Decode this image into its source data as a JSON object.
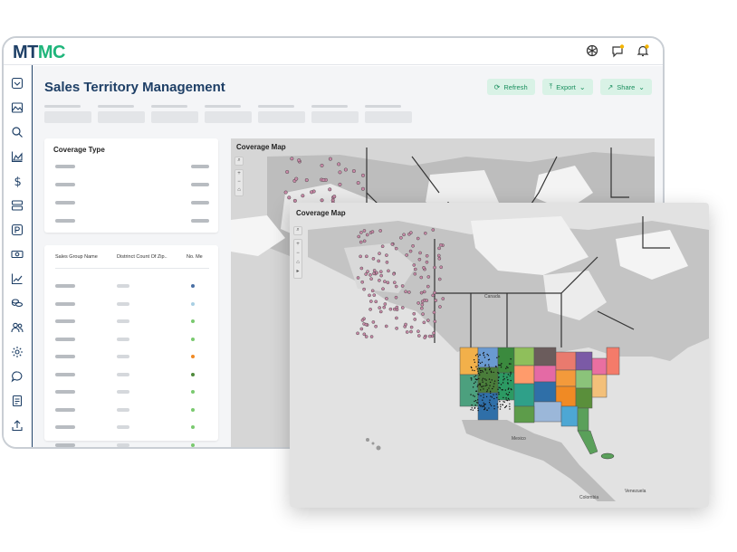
{
  "app": {
    "logo_part1": "MT",
    "logo_part2": "MC"
  },
  "page": {
    "title": "Sales Territory Management"
  },
  "actions": {
    "refresh": "Refresh",
    "export": "Export",
    "share": "Share"
  },
  "coverage_type": {
    "title": "Coverage Type"
  },
  "table": {
    "columns": [
      "Sales Group Name",
      "Distrinct Count Of Zip..",
      "No. Me"
    ],
    "dot_colors": [
      "#4a6fa5",
      "#a9cfe3",
      "#7ac96f",
      "#7ac96f",
      "#f08a24",
      "#4f8a3c",
      "#7ac96f",
      "#7ac96f",
      "#7ac96f",
      "#7ac96f"
    ]
  },
  "map": {
    "title": "Coverage Map",
    "zoom_in": "+",
    "zoom_out": "−",
    "label_canada": "Canada",
    "label_mexico": "Mexico",
    "label_colombia": "Colombia",
    "label_venezuela": "Venezuela"
  },
  "popup_map": {
    "title": "Coverage Map"
  },
  "icons": {
    "top": [
      "chatgpt-icon",
      "chat-notification-icon",
      "bell-icon"
    ],
    "sidebar": [
      "inbox-icon",
      "image-icon",
      "search-icon",
      "area-chart-icon",
      "dollar-icon",
      "database-icon",
      "parking-icon",
      "money-icon",
      "line-chart-icon",
      "coins-icon",
      "users-icon",
      "settings-icon",
      "chat-icon",
      "document-icon",
      "upload-icon"
    ]
  }
}
